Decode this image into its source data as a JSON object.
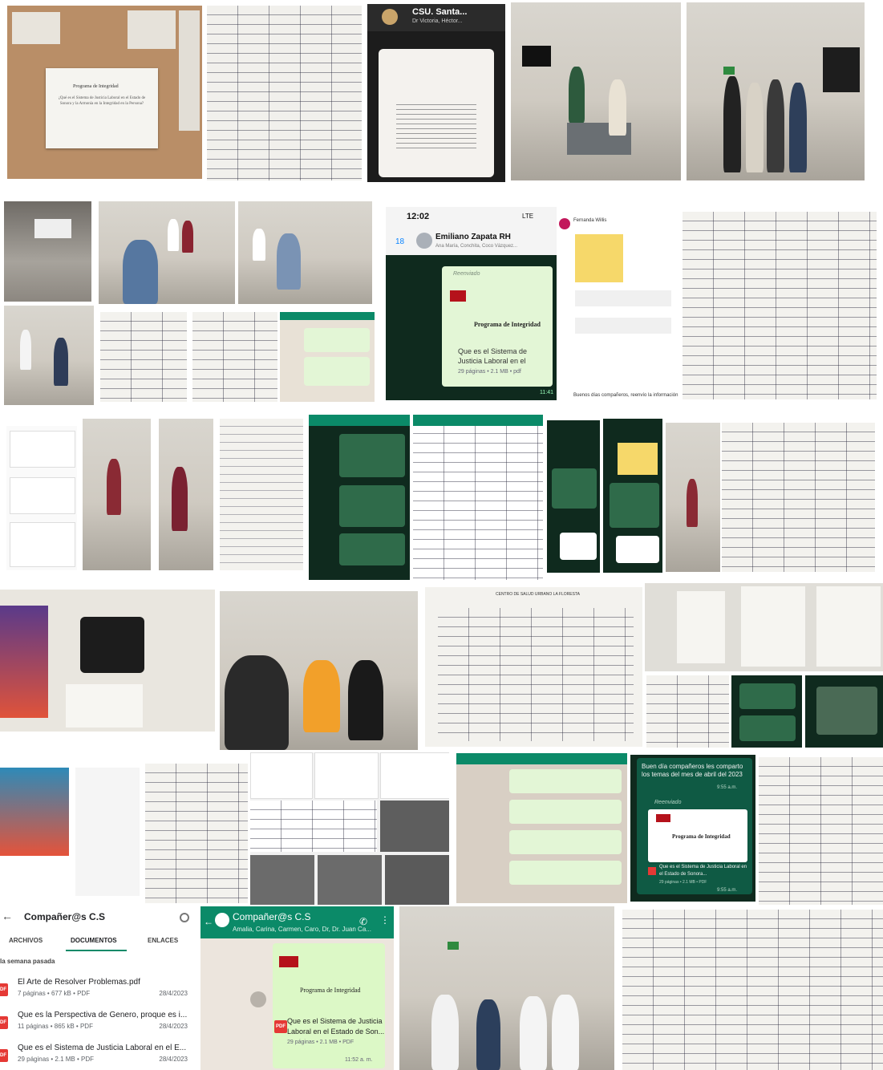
{
  "collage": {
    "tile_captions": {
      "poster_title": "Programa de Integridad",
      "poster_question": "¿Qué es el Sistema de Justicia Laboral en el Estado de Sonora y la Armonía en la Integridad en la Persona?",
      "csu_header": "CSU. Santa...",
      "csu_sub": "Dr Victoria, Héctor...",
      "sheet_title": "CENTRO DE SALUD URBANO LA FLORESTA"
    },
    "whatsapp_forward": {
      "time": "12:02",
      "network": "LTE",
      "back_count": "18",
      "contact": "Emiliano Zapata RH",
      "members": "Ana María, Conchita, Coco Vázquez...",
      "forwarded": "Reenviado",
      "program": "Programa de Integridad",
      "doc_title": "Que es el Sistema de Justicia Laboral en el Estado de Sonora",
      "doc_meta": "29 páginas • 2.1 MB • pdf",
      "msg_time": "11:41"
    },
    "fernanda_post": {
      "author": "Fernanda Willis",
      "footer": "Buenos días compañeros, reenvío la información"
    },
    "share_message": {
      "text": "Buen día compañeros les comparto los temas del mes de abril del 2023",
      "time1": "9:55 a.m.",
      "forwarded": "Reenviado",
      "program": "Programa de Integridad",
      "doc_title": "Que es el Sistema de Justicia Laboral en el Estado de Sonora...",
      "doc_meta": "29 páginas • 2.1 MB • PDF",
      "time2": "9:55 a.m."
    }
  },
  "files_panel": {
    "back_icon": "arrow-left-icon",
    "title": "Compañer@s C.S",
    "search_icon": "search-icon",
    "tabs": [
      "ARCHIVOS",
      "DOCUMENTOS",
      "ENLACES"
    ],
    "active_tab": "DOCUMENTOS",
    "section": "la semana pasada",
    "files": [
      {
        "name": "El Arte de Resolver Problemas.pdf",
        "meta": "7 páginas • 677 kB • PDF",
        "date": "28/4/2023",
        "badge": "PDF"
      },
      {
        "name": "Que es la Perspectiva de Genero, proque es i...",
        "meta": "11 páginas • 865 kB • PDF",
        "date": "28/4/2023",
        "badge": "PDF"
      },
      {
        "name": "Que es el Sistema de Justicia Laboral en el E...",
        "meta": "29 páginas • 2.1 MB • PDF",
        "date": "28/4/2023",
        "badge": "PDF"
      }
    ]
  },
  "chat_panel": {
    "title": "Compañer@s C.S",
    "members": "Amalia, Carina, Carmen, Caro, Dr, Dr. Juan Ca...",
    "program": "Programa de Integridad",
    "doc_title_1": "Que es el Sistema de Justicia",
    "doc_title_2": "Laboral en el Estado de Son...",
    "doc_meta": "29 páginas • 2.1 MB • PDF",
    "time": "11:52 a. m.",
    "pdf_badge": "PDF"
  },
  "colors": {
    "whatsapp_green": "#0b8a68",
    "whatsapp_dark": "#0f2a1e",
    "bubble_green": "#e3f6d6",
    "pdf_red": "#e53935",
    "sonora_red": "#b5121b"
  }
}
